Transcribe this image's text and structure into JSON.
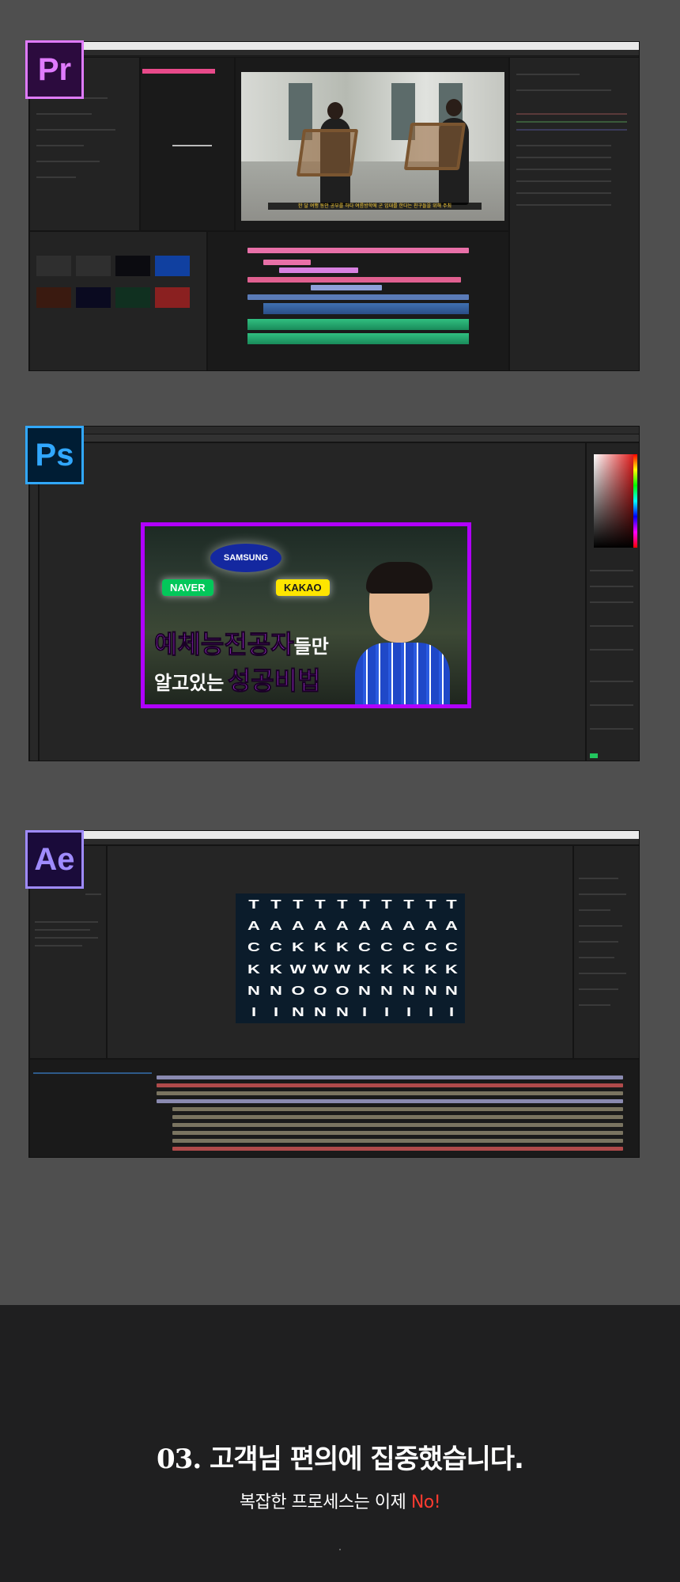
{
  "apps": [
    {
      "id": "premiere",
      "badge": "Pr",
      "color": "#e07bff"
    },
    {
      "id": "photoshop",
      "badge": "Ps",
      "color": "#31a8ff"
    },
    {
      "id": "aftereffects",
      "badge": "Ae",
      "color": "#9f8bff"
    }
  ],
  "premiere": {
    "subtitle": "한 달 여행 동안 공부를 하다 여름방학에 군 입대를 한다는 친구들을 위해 주최"
  },
  "photoshop": {
    "thumbnail": {
      "logos": {
        "samsung": "SAMSUNG",
        "naver": "NAVER",
        "kakao": "KAKAO"
      },
      "line1_highlight": "예체능전공자",
      "line1_rest": "들만",
      "line2_rest": "알고있는",
      "line2_highlight": "성공비법"
    }
  },
  "aftereffects": {
    "columns": [
      "TACKNI",
      "TACKNI",
      "TAKWON",
      "TAKWON",
      "TAKWON",
      "TACKNI",
      "TACKNI",
      "TACKNI",
      "TACKNI",
      "TACKNI"
    ]
  },
  "section": {
    "number": "03.",
    "title": "고객님 편의에 집중했습니다.",
    "subtitle_main": "복잡한 프로세스는 이제",
    "subtitle_accent": "No!"
  }
}
